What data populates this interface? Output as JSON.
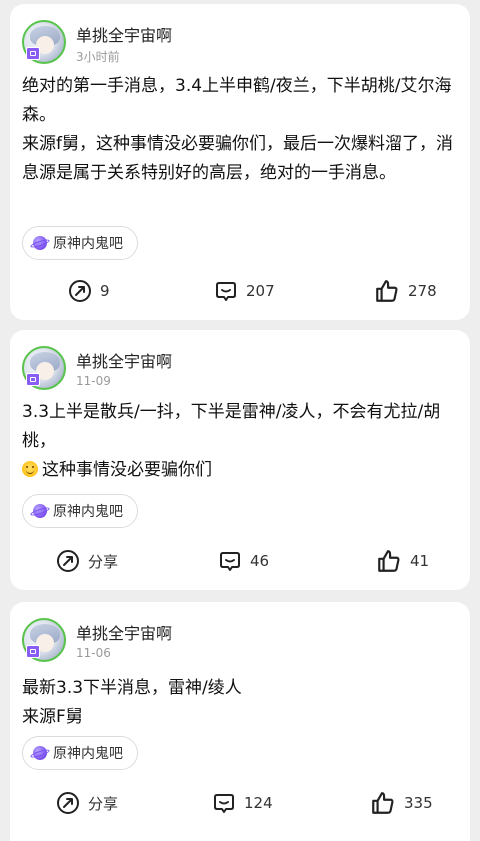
{
  "posts": [
    {
      "author": "单挑全宇宙啊",
      "time": "3小时前",
      "lines": [
        "绝对的第一手消息，3.4上半申鹤/夜兰，下半胡桃/艾尔海森。",
        "来源f舅，这种事情没必要骗你们，最后一次爆料溜了，消息源是属于关系特别好的高层，绝对的一手消息。"
      ],
      "tag": "原神内鬼吧",
      "share": "9",
      "comments": "207",
      "likes": "278"
    },
    {
      "author": "单挑全宇宙啊",
      "time": "11-09",
      "lines": [
        "3.3上半是散兵/一抖，下半是雷神/凌人，不会有尤拉/胡桃，",
        "这种事情没必要骗你们"
      ],
      "tag": "原神内鬼吧",
      "share": "分享",
      "comments": "46",
      "likes": "41"
    },
    {
      "author": "单挑全宇宙啊",
      "time": "11-06",
      "lines": [
        "最新3.3下半消息，雷神/绫人",
        "来源F舅"
      ],
      "tag": "原神内鬼吧",
      "share": "分享",
      "comments": "124",
      "likes": "335"
    }
  ],
  "icons": {
    "avatar_ring": "#57c44a",
    "tag_planet": "planet-icon",
    "share": "share-icon",
    "comment": "comment-icon",
    "like": "thumbs-up-icon"
  }
}
